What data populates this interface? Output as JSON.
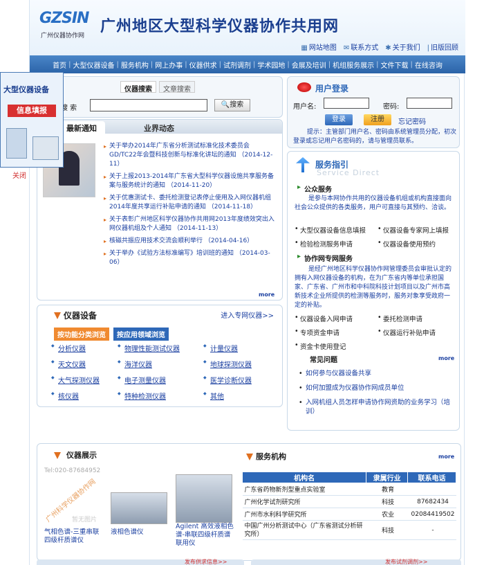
{
  "header": {
    "logo_text": "GZSIN",
    "logo_sub": "广州仪器协作网",
    "title": "广州地区大型科学仪器协作共用网",
    "links": [
      {
        "icon": "sitemap-icon",
        "label": "网站地图"
      },
      {
        "icon": "mail-icon",
        "label": "联系方式"
      },
      {
        "icon": "about-icon",
        "label": "关于我们"
      },
      {
        "icon": "back-icon",
        "label": "旧版回顾"
      }
    ]
  },
  "nav": [
    "首页",
    "大型仪器设备",
    "服务机构",
    "网上办事",
    "仪器供求",
    "试剂调剂",
    "学术园地",
    "会展及培训",
    "机组服务展示",
    "文件下载",
    "在线咨询"
  ],
  "search": {
    "tab_active": "仪器搜索",
    "tab_other": "文章搜索",
    "label": "搜 索",
    "value": "",
    "button": "搜索"
  },
  "float_ad": {
    "line1": "大型仪器设备",
    "line2": "信息填报",
    "close": "关闭"
  },
  "news": {
    "tab_latest": "最新通知",
    "tab_industry": "业界动态",
    "items": [
      "关于举办2014年广东省分析测试标准化技术委员会GD/TC22年会暨科技创新与标准化讲坛的通知 （2014-12-11）",
      "关于上报2013-2014年广东省大型科学仪器设施共享服务备案与服务统计的通知 （2014-11-20）",
      "关于优惠测试卡、委托检测登记表停止使用及入网仪器机组2014年度共享运行补贴申请的通知 （2014-11-18）",
      "关于表彰广州地区科学仪器协作共用网2013年度绩效突出入网仪器机组及个人通知 （2014-11-13）",
      "核磁共振应用技术交流会顺利举行 （2014-04-16）",
      "关于举办《试验方法标准编写》培训班的通知 （2014-03-06）"
    ],
    "more": "more"
  },
  "instruments": {
    "title": "仪器设备",
    "link": "进入专网仪器>>",
    "tab1": "按功能分类浏览",
    "tab2": "按应用领域浏览",
    "items": [
      "分析仪器",
      "物理性能测试仪器",
      "计量仪器",
      "天文仪器",
      "海洋仪器",
      "地球探测仪器",
      "大气探测仪器",
      "电子测量仪器",
      "医学诊断仪器",
      "核仪器",
      "特种检测仪器",
      "其他"
    ]
  },
  "login": {
    "title": "用户登录",
    "user_label": "用户名:",
    "pass_label": "密码:",
    "login_btn": "登录",
    "register_btn": "注册",
    "forgot": "忘记密码",
    "hint": "提示：主管部门用户名、密码由系统管理员分配，初次登录或忘记用户名密码的，请与管理员联系。"
  },
  "guide": {
    "title": "服务指引",
    "subtitle_en": "Service Direct",
    "public_title": "公众服务",
    "public_desc": "是参与本网协作共用的仪器设备机组或机构直接面向社会公众提供的各类服务，用户可直接与其预约、洽谈。",
    "public_items": [
      "大型仪器设备信息填报",
      "仪器设备专家网上填报",
      "检验检测服务申请",
      "仪器设备使用预约"
    ],
    "special_title": "协作网专网服务",
    "special_desc": "是经广州地区科学仪器协作网管理委员会审批认定的拥有入网仪器设备的机构，在为广东省内等单位承担国家、广东省、广州市和中科院科技计划项目以及广州市高新技术企业所提供的检测等服务时，服务对象享受政府一定的补贴。",
    "special_items": [
      "仪器设备入网申请",
      "委托检测申请",
      "专项资金申请",
      "仪器运行补贴申请",
      "资金卡使用登记"
    ],
    "faq_title": "常见问题",
    "faq_more": "more",
    "faq": [
      "如何参与仪器设备共享",
      "如何加盟成为仪器协作网成员单位",
      "入网机组人员怎样申请协作网资助的业务学习（培训）"
    ]
  },
  "showcase": {
    "title": "仪器展示",
    "watermark_tel": "Tel:020-87684952",
    "watermark_slant": "广州科学仪器协作网",
    "no_image": "暂无图片",
    "items": [
      "气相色谱-三重串联四级杆质谱仪",
      "液相色谱仪",
      "Agilent 高效液相色谱-串联四级杆质谱联用仪"
    ]
  },
  "orgs": {
    "title": "服务机构",
    "more": "more",
    "headers": [
      "机构名",
      "隶属行业",
      "联系电话"
    ],
    "rows": [
      [
        "广东省药物新剂型重点实验室",
        "教育",
        ""
      ],
      [
        "广州化学试剂研究所",
        "科技",
        "87682434"
      ],
      [
        "广州市水利科学研究所",
        "农业",
        "02084419502"
      ],
      [
        "中国广州分析测试中心（广东省测试分析研究所）",
        "科技",
        "-"
      ]
    ]
  },
  "bottom_partial": [
    "发布供求信息>>",
    "发布试剂调剂>>"
  ],
  "colors": {
    "brand_blue": "#2e68b8",
    "nav_blue": "#3a76be",
    "accent_orange": "#f08a30",
    "link_blue": "#1a3fa0"
  }
}
